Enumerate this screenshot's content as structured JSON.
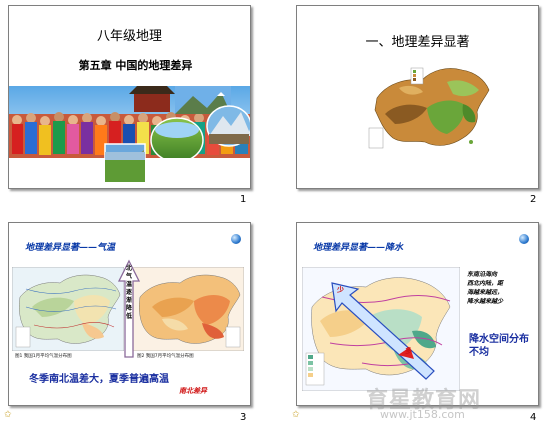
{
  "slides": [
    {
      "number": "1",
      "title": "八年级地理",
      "chapter": "第五章 中国的地理差异"
    },
    {
      "number": "2",
      "title": "一、地理差异显著"
    },
    {
      "number": "3",
      "header": "地理差异显著——气温",
      "arrow_text": [
        "北",
        "气",
        "温",
        "逐",
        "渐",
        "降",
        "低"
      ],
      "map1_caption": "图1 我国1月平均气温分布图",
      "map2_caption": "图2 我国7月平均气温分布图",
      "summary": "冬季南北温差大，夏季普遍高温",
      "note": "南北差异"
    },
    {
      "number": "4",
      "header": "地理差异显著——降水",
      "side_text": [
        "东南沿海向",
        "西北内陆，距",
        "海越来越远，",
        "降水越来越少"
      ],
      "summary": "降水空间分布不均",
      "label_less": "少",
      "label_more": "多",
      "watermark": "育星教育网",
      "watermark_url": "www.jt158.com"
    }
  ]
}
